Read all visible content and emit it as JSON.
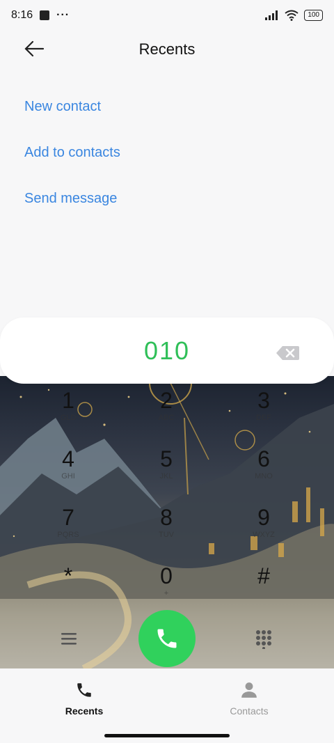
{
  "status": {
    "time": "8:16",
    "dots": "···",
    "battery": "100"
  },
  "header": {
    "title": "Recents"
  },
  "options": [
    "New contact",
    "Add to contacts",
    "Send message"
  ],
  "dialer": {
    "number": "010",
    "keys": [
      {
        "digit": "1",
        "letters": "GLD"
      },
      {
        "digit": "2",
        "letters": "ABC"
      },
      {
        "digit": "3",
        "letters": "DEF"
      },
      {
        "digit": "4",
        "letters": "GHI"
      },
      {
        "digit": "5",
        "letters": "JKL"
      },
      {
        "digit": "6",
        "letters": "MNO"
      },
      {
        "digit": "7",
        "letters": "PQRS"
      },
      {
        "digit": "8",
        "letters": "TUV"
      },
      {
        "digit": "9",
        "letters": "WXYZ"
      },
      {
        "digit": "*",
        "letters": ""
      },
      {
        "digit": "0",
        "letters": "+"
      },
      {
        "digit": "#",
        "letters": ""
      }
    ]
  },
  "tabs": {
    "recents": "Recents",
    "contacts": "Contacts"
  },
  "colors": {
    "accent": "#3a86e0",
    "call": "#30d15c",
    "number": "#2fbf58"
  }
}
